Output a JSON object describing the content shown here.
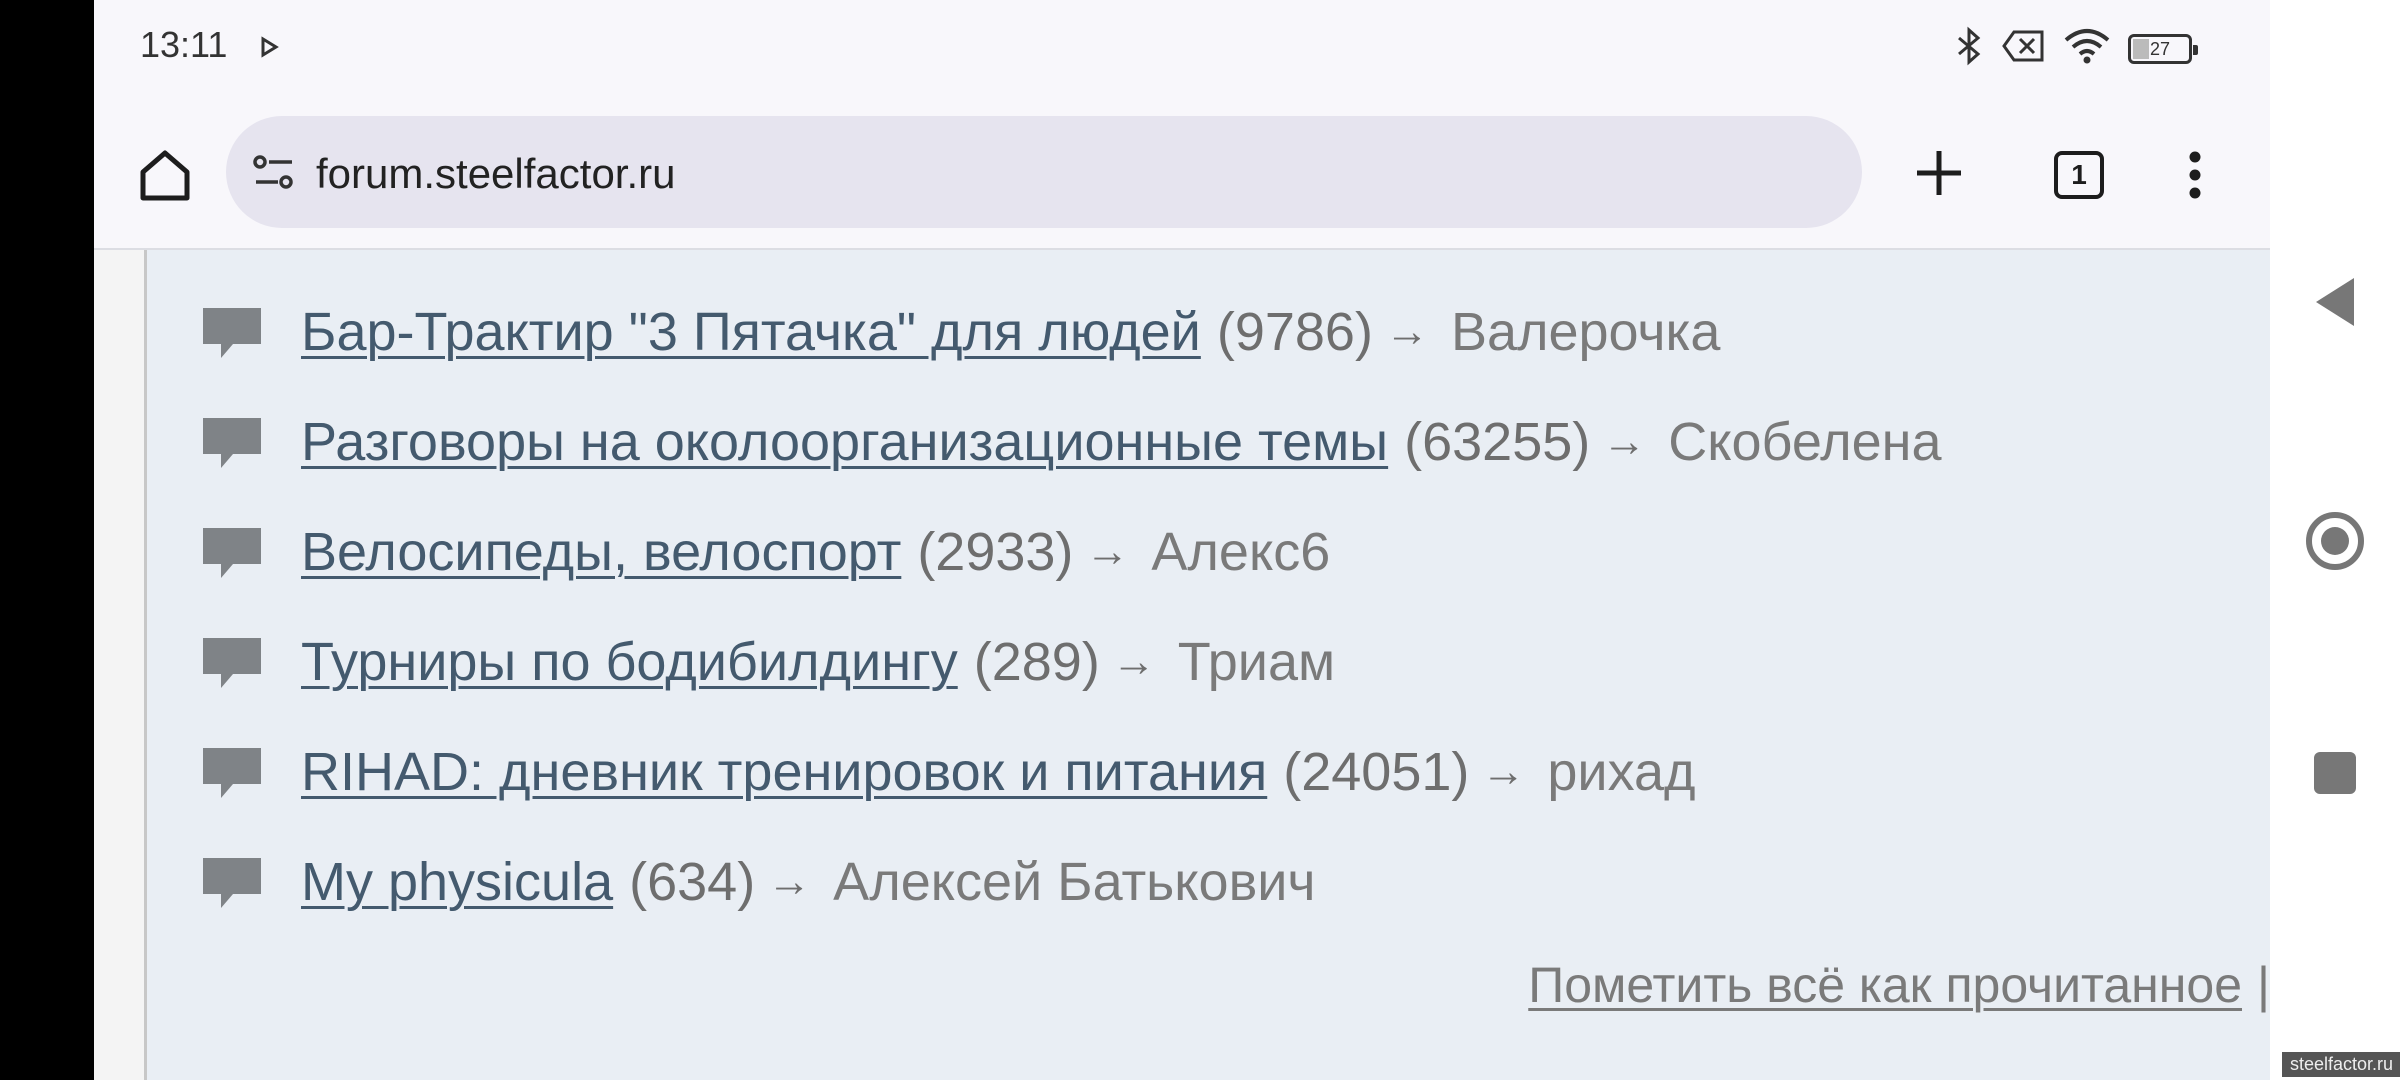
{
  "status_bar": {
    "time": "13:11",
    "battery": "27"
  },
  "browser": {
    "url": "forum.steelfactor.ru",
    "tab_count": "1"
  },
  "topics": [
    {
      "title": "Бар-Трактир \"3 Пятачка\" для людей",
      "count": "(9786)",
      "arrow": "→",
      "author": "Валерочка"
    },
    {
      "title": "Разговоры на околоорганизационные темы",
      "count": "(63255)",
      "arrow": "→",
      "author": "Скобелена"
    },
    {
      "title": "Велосипеды, велоспорт",
      "count": "(2933)",
      "arrow": "→",
      "author": "Алекс6"
    },
    {
      "title": "Турниры по бодибилдингу",
      "count": "(289)",
      "arrow": "→",
      "author": "Триам"
    },
    {
      "title": "RIHAD: дневник тренировок и питания",
      "count": "(24051)",
      "arrow": "→",
      "author": "рихад"
    },
    {
      "title": "My physicula",
      "count": "(634)",
      "arrow": "→",
      "author": "Алексей Батькович"
    }
  ],
  "footer": {
    "mark_all_read": "Пометить всё как прочитанное",
    "separator": "|"
  },
  "watermark": "steelfactor.ru"
}
